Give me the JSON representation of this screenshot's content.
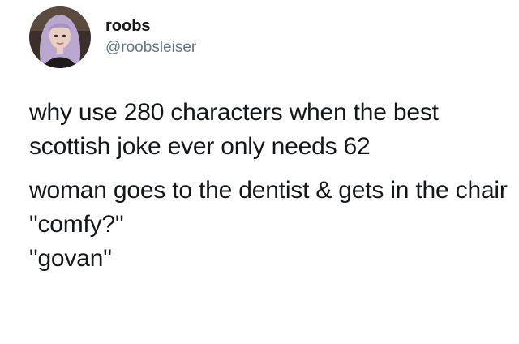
{
  "author": {
    "display_name": "roobs",
    "handle": "@roobsleiser"
  },
  "tweet": {
    "lines": [
      "why use 280 characters when the best scottish joke ever only needs 62",
      "woman goes to the dentist & gets in the chair",
      "\"comfy?\"",
      "\"govan\""
    ]
  },
  "colors": {
    "text": "#14171a",
    "handle": "#657786",
    "background": "#ffffff"
  }
}
